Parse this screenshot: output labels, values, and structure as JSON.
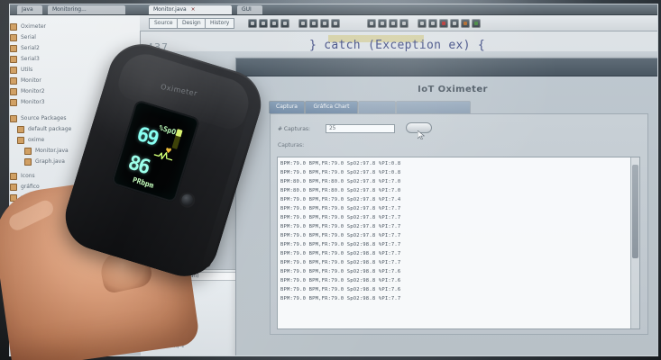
{
  "editor": {
    "line_number": "437",
    "code_line": "} catch (Exception ex) {",
    "toolbar_buttons": [
      "Source",
      "Design",
      "History"
    ]
  },
  "oximeter_window": {
    "title": "IoT Oximeter",
    "tabs": [
      "Captura",
      "Gráfica Chart"
    ],
    "captures_label": "# Capturas:",
    "captures_value": "25",
    "captures_heading": "Capturas:"
  },
  "capture_rows": [
    "BPM:79.0 BPM,FR:79.0 SpO2:97.8 %PI:0.8",
    "BPM:79.0 BPM,FR:79.0 SpO2:97.8 %PI:0.8",
    "BPM:80.0 BPM,FR:80.0 SpO2:97.8 %PI:7.0",
    "BPM:80.0 BPM,FR:80.0 SpO2:97.8 %PI:7.0",
    "BPM:79.0 BPM,FR:79.0 SpO2:97.8 %PI:7.4",
    "BPM:79.0 BPM,FR:79.0 SpO2:97.8 %PI:7.7",
    "BPM:79.0 BPM,FR:79.0 SpO2:97.8 %PI:7.7",
    "BPM:79.0 BPM,FR:79.0 SpO2:97.8 %PI:7.7",
    "BPM:79.0 BPM,FR:79.0 SpO2:97.8 %PI:7.7",
    "BPM:79.0 BPM,FR:79.0 SpO2:98.8 %PI:7.7",
    "BPM:79.0 BPM,FR:79.0 SpO2:98.8 %PI:7.7",
    "BPM:79.0 BPM,FR:79.0 SpO2:98.8 %PI:7.7",
    "BPM:79.0 BPM,FR:79.0 SpO2:98.8 %PI:7.6",
    "BPM:79.0 BPM,FR:79.0 SpO2:98.8 %PI:7.6",
    "BPM:79.0 BPM,FR:79.0 SpO2:98.8 %PI:7.6",
    "BPM:79.0 BPM,FR:79.0 SpO2:98.8 %PI:7.7"
  ],
  "device_display": {
    "spo2_value": "69",
    "pr_value": "86",
    "spo2_label": "%SpO2",
    "pr_label": "PRbpm"
  },
  "colors": {
    "tab_blue": "#7f98b5",
    "display_cyan": "#88fff2",
    "display_yellow": "#f0bf3a"
  }
}
